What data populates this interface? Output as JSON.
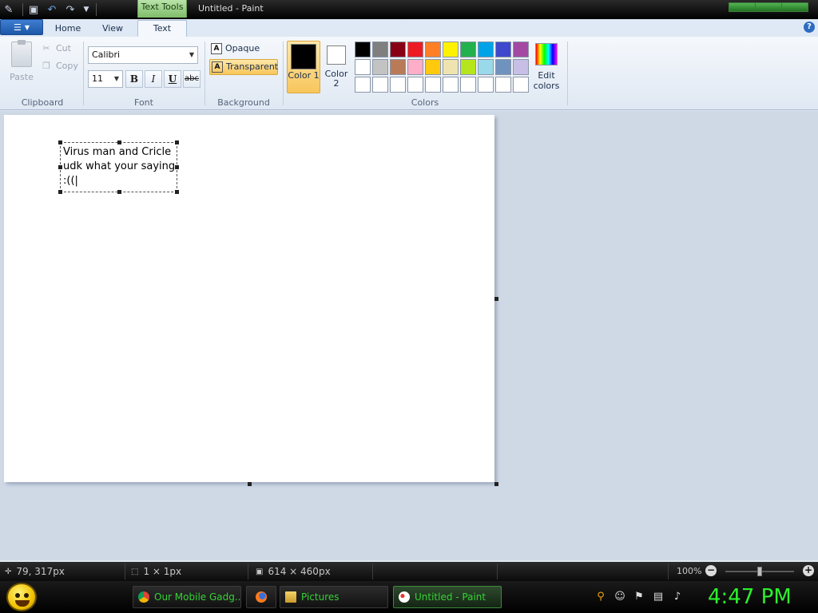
{
  "titlebar": {
    "contextual_tab": "Text Tools",
    "title": "Untitled - Paint"
  },
  "tabs": {
    "home": "Home",
    "view": "View",
    "text": "Text"
  },
  "clipboard": {
    "paste": "Paste",
    "cut": "Cut",
    "copy": "Copy",
    "label": "Clipboard"
  },
  "font": {
    "name": "Calibri",
    "size": "11",
    "bold": "B",
    "italic": "I",
    "underline": "U",
    "strike": "abc",
    "label": "Font"
  },
  "background": {
    "opaque": "Opaque",
    "transparent": "Transparent",
    "label": "Background"
  },
  "colors": {
    "color1": "Color 1",
    "color2": "Color 2",
    "edit": "Edit colors",
    "label": "Colors",
    "palette_row1": [
      "#000000",
      "#7f7f7f",
      "#880015",
      "#ed1c24",
      "#ff7f27",
      "#fff200",
      "#22b14c",
      "#00a2e8",
      "#3f48cc",
      "#a349a4"
    ],
    "palette_row2": [
      "#ffffff",
      "#c3c3c3",
      "#b97a57",
      "#ffaec9",
      "#ffc90e",
      "#efe4b0",
      "#b5e61d",
      "#99d9ea",
      "#7092be",
      "#c8bfe7"
    ],
    "palette_row3": [
      "#ffffff",
      "#ffffff",
      "#ffffff",
      "#ffffff",
      "#ffffff",
      "#ffffff",
      "#ffffff",
      "#ffffff",
      "#ffffff",
      "#ffffff"
    ]
  },
  "canvas": {
    "text": "Virus man and Cricle udk what your saying :((|"
  },
  "status": {
    "cursor": "79, 317px",
    "selection": "1 × 1px",
    "size": "614 × 460px",
    "zoom": "100%"
  },
  "taskbar": {
    "chrome": "Our Mobile Gadg...",
    "pictures": "Pictures",
    "paint": "Untitled - Paint",
    "clock": "4:47 PM"
  }
}
